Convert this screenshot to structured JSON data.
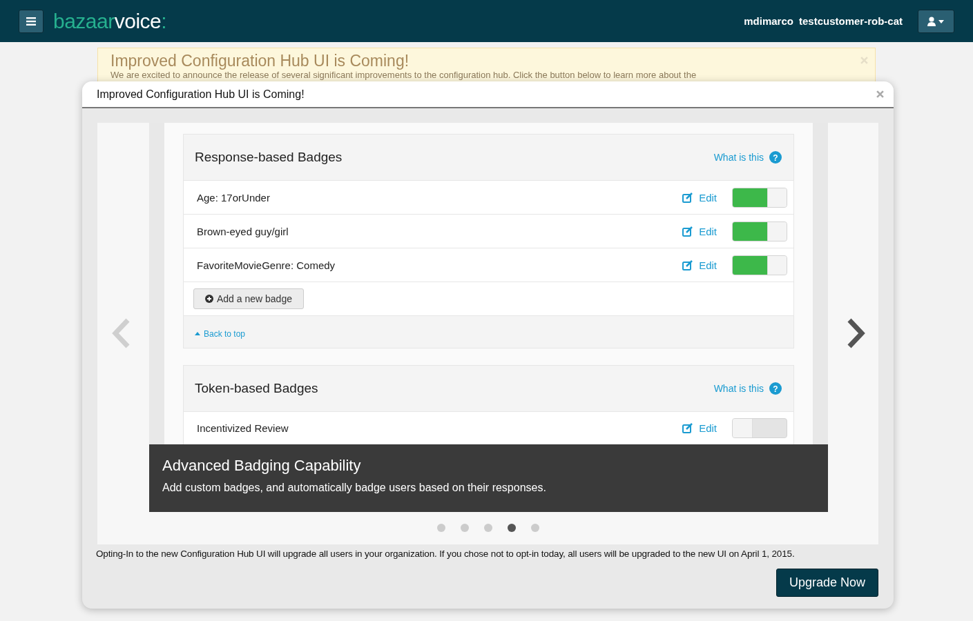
{
  "topbar": {
    "logo_part_1": "bazaar",
    "logo_part_2": "voice",
    "logo_colon": ":",
    "user": "mdimarco",
    "account": "testcustomer-rob-cat"
  },
  "banner": {
    "title": "Improved Configuration Hub UI is Coming!",
    "text": "We are excited to announce the release of several significant improvements to the configuration hub. Click the button below to learn more about the"
  },
  "modal": {
    "title": "Improved Configuration Hub UI is Coming!",
    "slide": {
      "sections": [
        {
          "title": "Response-based Badges",
          "help": "What is this",
          "help_icon": "?",
          "rows": [
            {
              "name": "Age: 17orUnder",
              "edit": "Edit",
              "on": true
            },
            {
              "name": "Brown-eyed guy/girl",
              "edit": "Edit",
              "on": true
            },
            {
              "name": "FavoriteMovieGenre: Comedy",
              "edit": "Edit",
              "on": true
            }
          ],
          "add": "Add a new badge",
          "back": "Back to top"
        },
        {
          "title": "Token-based Badges",
          "help": "What is this",
          "help_icon": "?",
          "rows": [
            {
              "name": "Incentivized Review",
              "edit": "Edit",
              "on": false
            }
          ]
        }
      ],
      "caption_title": "Advanced Badging Capability",
      "caption_text": "Add custom badges, and automatically badge users based on their responses."
    },
    "dots": [
      {
        "selected": false
      },
      {
        "selected": false
      },
      {
        "selected": false
      },
      {
        "selected": true
      },
      {
        "selected": false
      }
    ],
    "note": "Opting-In to the new Configuration Hub UI will upgrade all users in your organization. If you chose not to opt-in today, all users will be upgraded to the new UI on April 1, 2015.",
    "button": "Upgrade Now"
  }
}
